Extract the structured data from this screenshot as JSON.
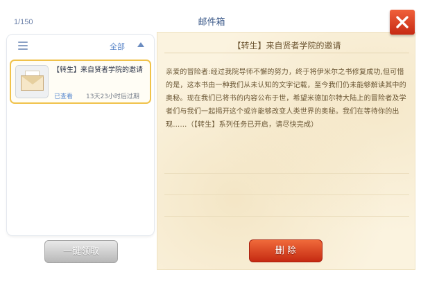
{
  "header": {
    "mail_count": "1/150",
    "title": "邮件箱"
  },
  "list": {
    "filter_label": "全部",
    "items": [
      {
        "subject": "【转生】来自贤者学院的邀请",
        "status": "已查看",
        "expire": "13天23小时后过期",
        "icon": "envelope-icon"
      }
    ],
    "claim_all_label": "一键领取"
  },
  "letter": {
    "title": "【转生】来自贤者学院的邀请",
    "body": "亲爱的冒险者:经过我院导师不懈的努力，终于将伊米尔之书修复成功,但可惜的是，这本书由一种我们从未认知的文字记载，至今我们仍未能够解读其中的奥秘。现在我们已将书的内容公布于世，希望米德加尔特大陆上的冒险者及学者们与我们一起揭开这个或许能够改变人类世界的奥秘。我们在等待你的出现……（【转生】系列任务已开启，请尽快完成）",
    "delete_label": "删 除"
  },
  "colors": {
    "accent": "#f0c24a",
    "delete": "#c52a12",
    "link": "#5a86c8"
  }
}
